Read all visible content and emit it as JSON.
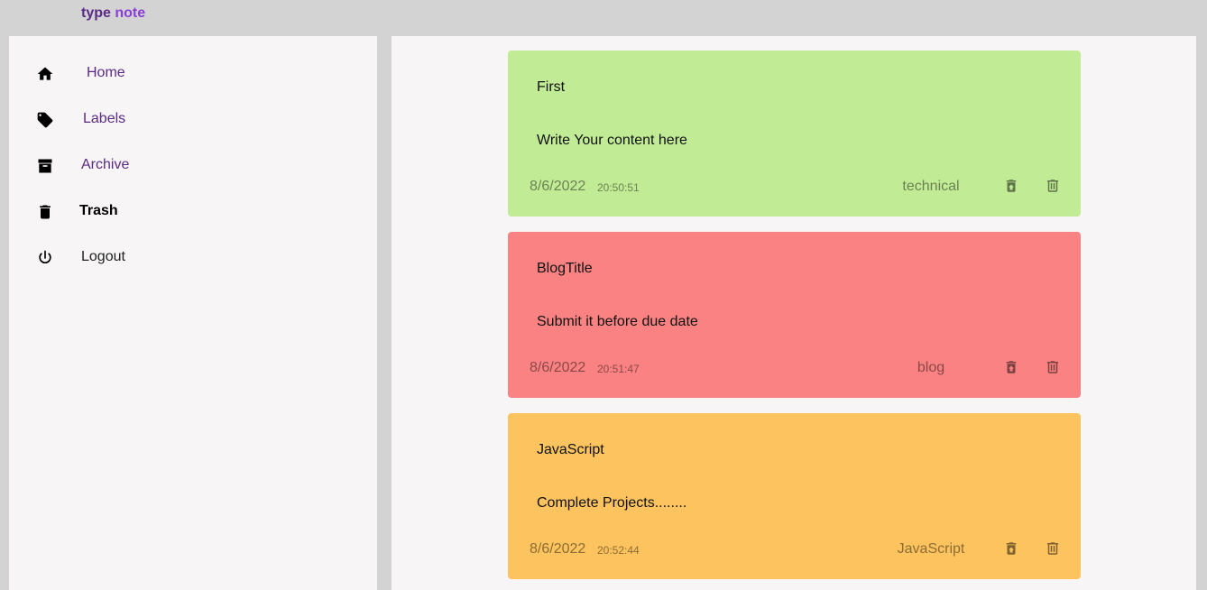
{
  "brand": {
    "part1": "type",
    "part2": "note"
  },
  "sidebar": {
    "items": [
      {
        "label": "Home",
        "icon": "home-icon"
      },
      {
        "label": "Labels",
        "icon": "tag-icon"
      },
      {
        "label": "Archive",
        "icon": "archive-icon"
      },
      {
        "label": "Trash",
        "icon": "trash-icon",
        "active": true
      },
      {
        "label": "Logout",
        "icon": "power-icon"
      }
    ]
  },
  "colors": {
    "accent": "#5b2a86",
    "card_green": "#c1eb95",
    "card_red": "#fa8282",
    "card_orange": "#fcc35e"
  },
  "notes": [
    {
      "title": "First",
      "content": "Write Your content here",
      "date": "8/6/2022",
      "time": "20:50:51",
      "label": "technical"
    },
    {
      "title": "BlogTitle",
      "content": "Submit it before due date",
      "date": "8/6/2022",
      "time": "20:51:47",
      "label": "blog"
    },
    {
      "title": "JavaScript",
      "content": "Complete Projects........",
      "date": "8/6/2022",
      "time": "20:52:44",
      "label": "JavaScript"
    }
  ]
}
